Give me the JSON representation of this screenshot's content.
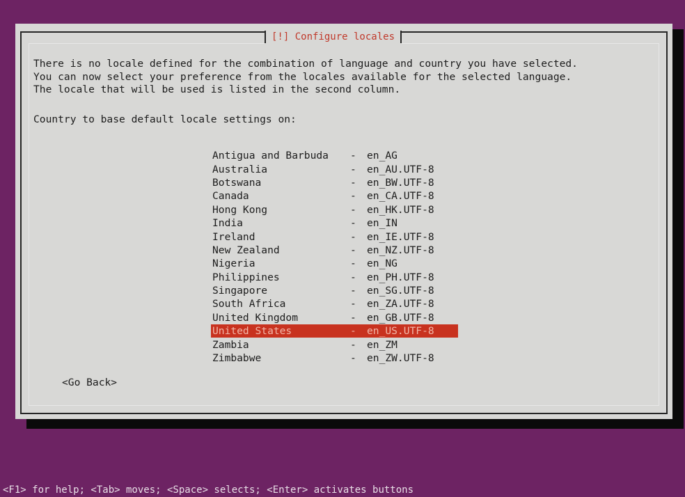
{
  "dialog": {
    "title": "[!] Configure locales",
    "message": "There is no locale defined for the combination of language and country you have selected.\nYou can now select your preference from the locales available for the selected language.\nThe locale that will be used is listed in the second column.",
    "prompt": "Country to base default locale settings on:",
    "separator": "-",
    "options": [
      {
        "country": "Antigua and Barbuda",
        "locale": "en_AG"
      },
      {
        "country": "Australia",
        "locale": "en_AU.UTF-8"
      },
      {
        "country": "Botswana",
        "locale": "en_BW.UTF-8"
      },
      {
        "country": "Canada",
        "locale": "en_CA.UTF-8"
      },
      {
        "country": "Hong Kong",
        "locale": "en_HK.UTF-8"
      },
      {
        "country": "India",
        "locale": "en_IN"
      },
      {
        "country": "Ireland",
        "locale": "en_IE.UTF-8"
      },
      {
        "country": "New Zealand",
        "locale": "en_NZ.UTF-8"
      },
      {
        "country": "Nigeria",
        "locale": "en_NG"
      },
      {
        "country": "Philippines",
        "locale": "en_PH.UTF-8"
      },
      {
        "country": "Singapore",
        "locale": "en_SG.UTF-8"
      },
      {
        "country": "South Africa",
        "locale": "en_ZA.UTF-8"
      },
      {
        "country": "United Kingdom",
        "locale": "en_GB.UTF-8"
      },
      {
        "country": "United States",
        "locale": "en_US.UTF-8"
      },
      {
        "country": "Zambia",
        "locale": "en_ZM"
      },
      {
        "country": "Zimbabwe",
        "locale": "en_ZW.UTF-8"
      }
    ],
    "selected_index": 13,
    "go_back_label": "<Go Back>"
  },
  "help_bar": "<F1> for help; <Tab> moves; <Space> selects; <Enter> activates buttons",
  "colors": {
    "background": "#6d2363",
    "dialog": "#d8d8d6",
    "title": "#c0392b",
    "selection": "#c8321f"
  }
}
